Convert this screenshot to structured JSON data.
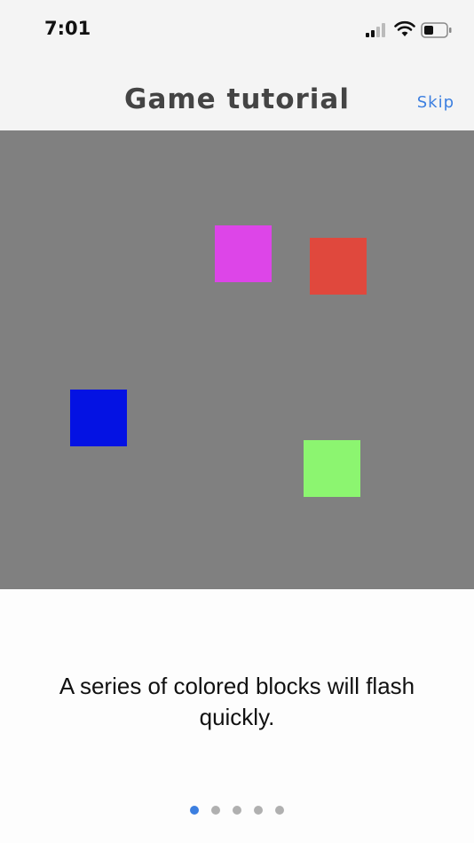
{
  "status_bar": {
    "time": "7:01",
    "icons": [
      "signal-icon",
      "wifi-icon",
      "battery-icon"
    ]
  },
  "nav": {
    "title": "Game tutorial",
    "skip_label": "Skip"
  },
  "game": {
    "background_color": "#808080",
    "blocks": [
      {
        "name": "magenta-block",
        "color": "#dd45e8"
      },
      {
        "name": "red-block",
        "color": "#e0483d"
      },
      {
        "name": "blue-block",
        "color": "#0412e3"
      },
      {
        "name": "green-block",
        "color": "#8cf570"
      }
    ]
  },
  "caption": "A series of colored blocks will flash quickly.",
  "pagination": {
    "total": 5,
    "current": 1,
    "active_color": "#3c7fe0",
    "inactive_color": "#b0b0b0"
  }
}
